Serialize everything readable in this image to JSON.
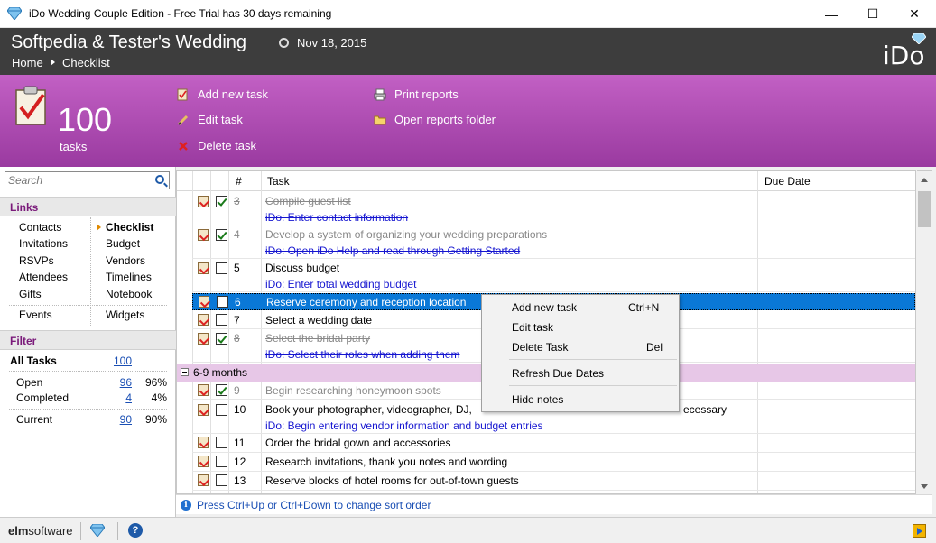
{
  "window": {
    "title": "iDo Wedding Couple Edition - Free Trial has 30 days remaining",
    "minimize_glyph": "—",
    "maximize_glyph": "☐",
    "close_glyph": "✕"
  },
  "header": {
    "wedding_title": "Softpedia & Tester's Wedding",
    "wedding_date": "Nov 18, 2015",
    "breadcrumb_home": "Home",
    "breadcrumb_page": "Checklist",
    "logo": "iDo"
  },
  "ribbon": {
    "task_count": "100",
    "task_count_label": "tasks",
    "actions": {
      "add": "Add new task",
      "edit": "Edit task",
      "delete": "Delete task",
      "print": "Print reports",
      "open_folder": "Open reports folder"
    }
  },
  "sidebar": {
    "search_placeholder": "Search",
    "links_heading": "Links",
    "links_left": [
      "Contacts",
      "Invitations",
      "RSVPs",
      "Attendees",
      "Gifts",
      "Events"
    ],
    "links_right": [
      "Checklist",
      "Budget",
      "Vendors",
      "Timelines",
      "Notebook",
      "Widgets"
    ],
    "filter_heading": "Filter",
    "filters": {
      "all_label": "All Tasks",
      "all_count": "100",
      "open_label": "Open",
      "open_count": "96",
      "open_pct": "96%",
      "completed_label": "Completed",
      "completed_count": "4",
      "completed_pct": "4%",
      "current_label": "Current",
      "current_count": "90",
      "current_pct": "90%"
    }
  },
  "grid": {
    "columns": {
      "num": "#",
      "task": "Task",
      "due": "Due Date"
    },
    "rows": [
      {
        "num": "3",
        "task": "Compile guest list",
        "note": "iDo:  Enter contact information",
        "done": true
      },
      {
        "num": "4",
        "task": "Develop a system of organizing your wedding preparations",
        "note": "iDo:  Open iDo Help and read through Getting Started",
        "done": true
      },
      {
        "num": "5",
        "task": "Discuss budget",
        "note": "iDo:  Enter total wedding budget",
        "done": false
      },
      {
        "num": "6",
        "task": "Reserve ceremony and reception location",
        "note": "",
        "done": false,
        "selected": true
      },
      {
        "num": "7",
        "task": "Select a wedding date",
        "note": "",
        "done": false
      },
      {
        "num": "8",
        "task": "Select the bridal party",
        "note": "iDo:  Select their roles when adding them",
        "done": true
      },
      {
        "num": "9",
        "task": "Begin researching honeymoon spots",
        "note": "",
        "done": true
      },
      {
        "num": "10",
        "task": "Book your photographer, videographer, DJ,",
        "task_tail": "ecessary",
        "note": "iDo:  Begin entering vendor information and budget entries",
        "done": false
      },
      {
        "num": "11",
        "task": "Order the bridal gown and accessories",
        "note": "",
        "done": false
      },
      {
        "num": "12",
        "task": "Research invitations, thank you notes and wording",
        "note": "",
        "done": false
      },
      {
        "num": "13",
        "task": "Reserve blocks of hotel rooms for out-of-town guests",
        "note": "",
        "done": false
      }
    ],
    "group_label": "6-9 months"
  },
  "hint": "Press Ctrl+Up or Ctrl+Down to change sort order",
  "statusbar": {
    "brand_a": "elm",
    "brand_b": "software",
    "help_glyph": "?"
  },
  "context_menu": {
    "items": [
      {
        "label": "Add new task",
        "shortcut": "Ctrl+N"
      },
      {
        "label": "Edit task",
        "shortcut": ""
      },
      {
        "label": "Delete Task",
        "shortcut": "Del"
      },
      {
        "label": "Refresh Due Dates",
        "shortcut": ""
      },
      {
        "label": "Hide notes",
        "shortcut": ""
      }
    ]
  },
  "colors": {
    "header_bg": "#3d3d3d",
    "ribbon": "#b04fb4",
    "accent_purple": "#7a1a7a",
    "link_blue": "#1a4fb4",
    "selection": "#0a78d7"
  }
}
